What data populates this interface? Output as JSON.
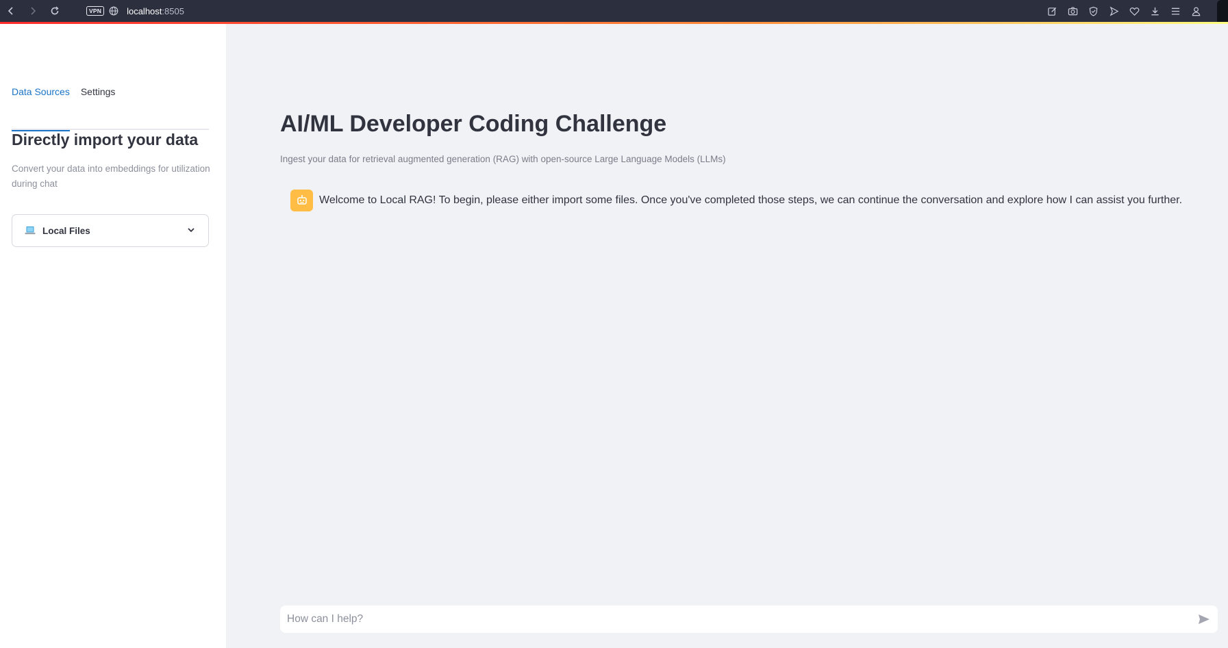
{
  "browser": {
    "url_host": "localhost",
    "url_port": ":8505",
    "vpn_label": "VPN",
    "icons": [
      "back-icon",
      "forward-icon",
      "reload-icon",
      "globe-icon",
      "edit-icon",
      "camera-icon",
      "shield-icon",
      "play-icon",
      "heart-icon",
      "download-icon",
      "menu-icon",
      "profile-icon"
    ]
  },
  "sidebar": {
    "tabs": [
      {
        "label": "Data Sources",
        "active": true
      },
      {
        "label": "Settings",
        "active": false
      }
    ],
    "heading": "Directly import your data",
    "caption": "Convert your data into embeddings for utilization during chat",
    "expander": {
      "icon": "laptop-icon",
      "label": "Local Files"
    }
  },
  "main": {
    "title": "AI/ML Developer Coding Challenge",
    "caption": "Ingest your data for retrieval augmented generation (RAG) with open-source Large Language Models (LLMs)",
    "message": {
      "avatar_icon": "robot-icon",
      "text": "Welcome to Local RAG! To begin, please either import some files. Once you've completed those steps, we can continue the conversation and explore how I can assist you further."
    },
    "chat_input": {
      "placeholder": "How can I help?",
      "value": ""
    }
  },
  "colors": {
    "accent": "#1a73c7",
    "bot_avatar": "#ffbd45",
    "background": "#f0f2f6",
    "sidebar": "#ffffff"
  }
}
